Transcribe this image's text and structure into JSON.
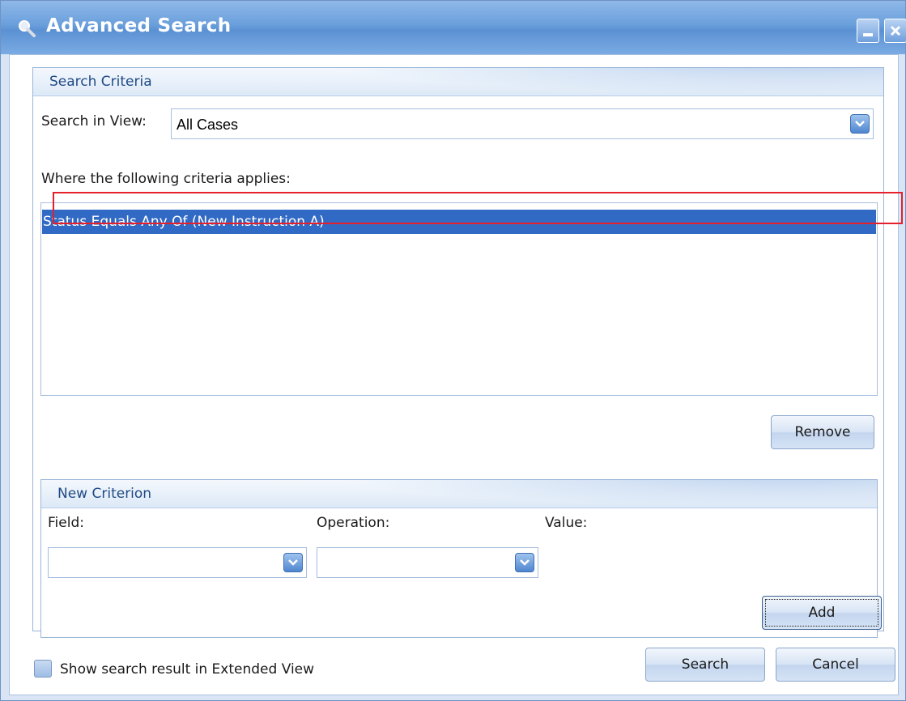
{
  "window": {
    "title": "Advanced Search",
    "icon": "magnifier-icon"
  },
  "search_criteria": {
    "group_title": "Search Criteria",
    "search_in_view_label": "Search in View:",
    "search_in_view_value": "All Cases",
    "criteria_label": "Where the following criteria applies:",
    "criteria_items": [
      {
        "text": "Status Equals Any Of (New Instruction A)",
        "selected": true
      }
    ],
    "remove_label": "Remove"
  },
  "new_criterion": {
    "group_title": "New Criterion",
    "field_label": "Field:",
    "field_value": "",
    "operation_label": "Operation:",
    "operation_value": "",
    "value_label": "Value:",
    "add_label": "Add"
  },
  "footer": {
    "extended_view_label": "Show search result in Extended View",
    "extended_view_checked": false,
    "search_label": "Search",
    "cancel_label": "Cancel"
  },
  "colors": {
    "selection": "#316ac5",
    "highlight_border": "#e5202a",
    "title_bar": "#6a9fdc",
    "group_title_text": "#1f4a86"
  }
}
